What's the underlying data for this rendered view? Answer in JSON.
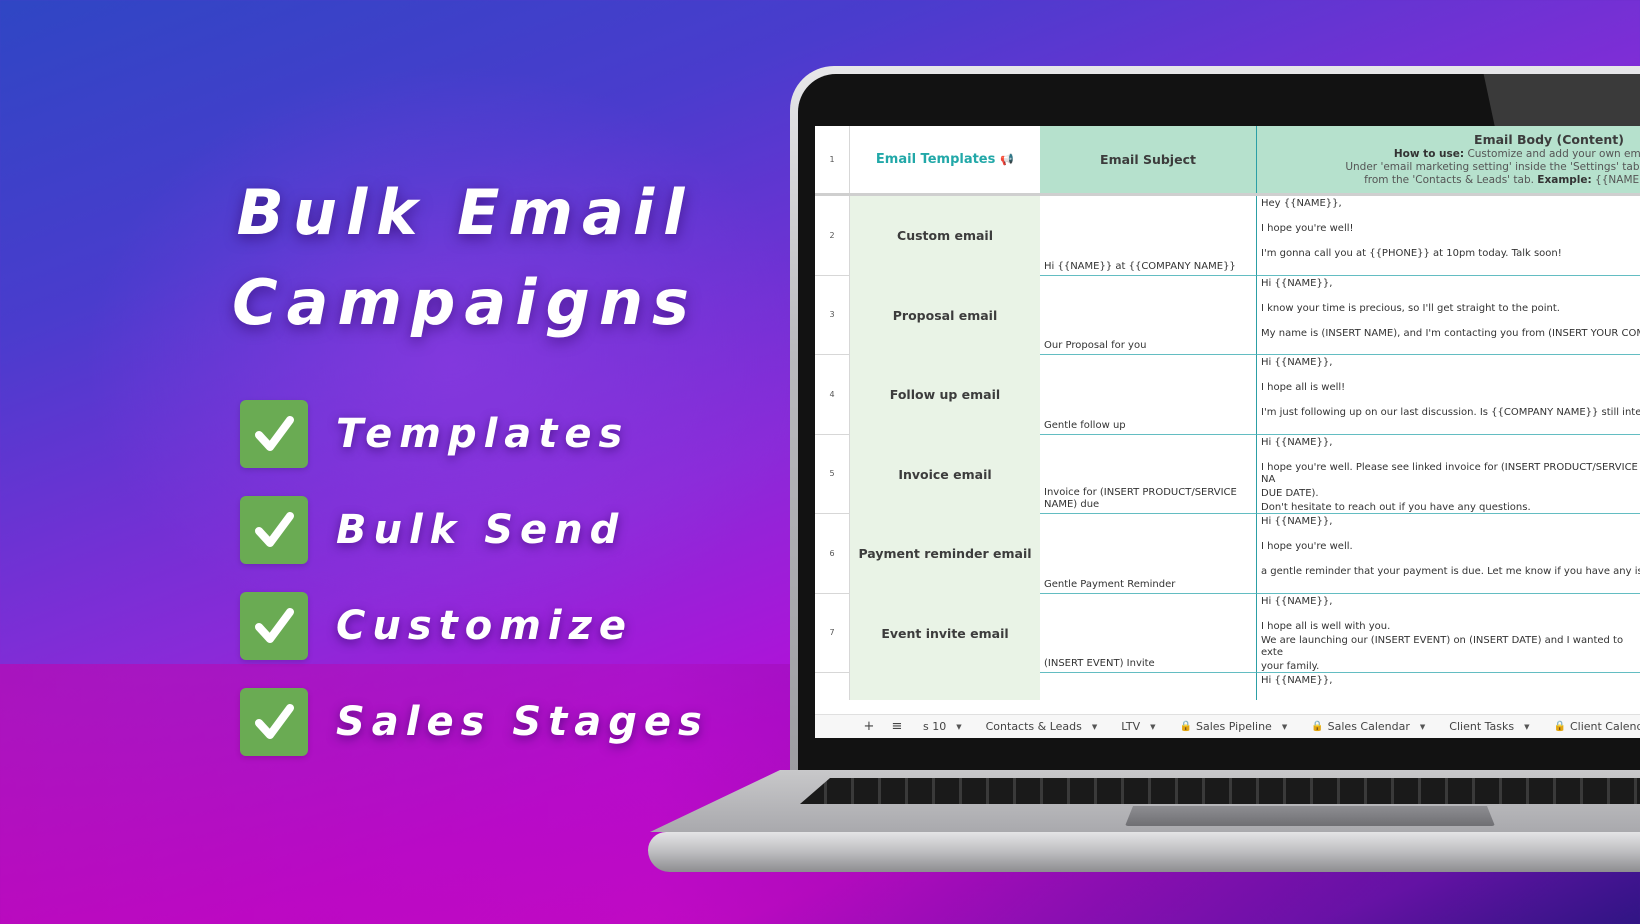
{
  "promo": {
    "headline_line1": "Bulk Email",
    "headline_line2": "Campaigns",
    "features": [
      {
        "label": "Templates",
        "icon": "checkmark-icon"
      },
      {
        "label": "Bulk Send",
        "icon": "checkmark-icon"
      },
      {
        "label": "Customize",
        "icon": "checkmark-icon"
      },
      {
        "label": "Sales Stages",
        "icon": "checkmark-icon"
      }
    ],
    "check_color": "#6aab53"
  },
  "spreadsheet": {
    "header": {
      "row_number": "1",
      "col_type": "Email Templates",
      "col_type_icon": "megaphone-icon",
      "col_subject": "Email Subject",
      "col_body_title": "Email Body (Content)",
      "col_body_howto_label": "How to use:",
      "col_body_howto_text": " Customize and add your own email subject a",
      "col_body_line2": "Under 'email marketing setting' inside the 'Settings' tab, you can add the coc",
      "col_body_line3_pre": "from the 'Contacts & Leads' tab. ",
      "col_body_example_label": "Example:",
      "col_body_line3_post": " {{NAME}} corrosponds to"
    },
    "rows": [
      {
        "row_number": "2",
        "type": "Custom email",
        "subject": "Hi {{NAME}} at {{COMPANY NAME}}",
        "body": [
          "Hey {{NAME}},",
          "I hope you're well!",
          "I'm gonna call you at {{PHONE}} at 10pm today. Talk soon!"
        ]
      },
      {
        "row_number": "3",
        "type": "Proposal email",
        "subject": "Our Proposal for you",
        "body": [
          "Hi {{NAME}},",
          "I know your time is precious, so I'll get straight to the point.",
          "My name is (INSERT NAME), and I'm contacting you from (INSERT YOUR COMP"
        ]
      },
      {
        "row_number": "4",
        "type": "Follow up email",
        "subject": "Gentle follow up",
        "body": [
          "Hi {{NAME}},",
          "I hope all is well!",
          "I'm just following up on our last discussion. Is {{COMPANY NAME}} still intereste"
        ]
      },
      {
        "row_number": "5",
        "type": "Invoice email",
        "subject": "Invoice for (INSERT PRODUCT/SERVICE NAME) due",
        "body": [
          "Hi {{NAME}},",
          "I hope you're well. Please see linked invoice for (INSERT PRODUCT/SERVICE NA",
          "DUE DATE).",
          "Don't hesitate to reach out if you have any questions."
        ]
      },
      {
        "row_number": "6",
        "type": "Payment reminder email",
        "subject": "Gentle Payment Reminder",
        "body": [
          "Hi {{NAME}},",
          "I hope you're well.",
          " a gentle reminder that your payment is due. Let me know if you have any issu"
        ]
      },
      {
        "row_number": "7",
        "type": "Event invite email",
        "subject": "(INSERT EVENT) Invite",
        "body": [
          "Hi {{NAME}},",
          "I hope all is well with you.",
          "We are launching our (INSERT EVENT) on (INSERT DATE) and I wanted to exte",
          "your family."
        ]
      }
    ],
    "partial_row_body": "Hi {{NAME}},",
    "accent_teal": "#22a8a8",
    "header_green": "#b6e1cd",
    "type_column_green": "#e9f3e6"
  },
  "tabbar": {
    "add_sheet": "+",
    "all_sheets": "≡",
    "tabs": [
      {
        "label": "s 10",
        "locked": false
      },
      {
        "label": "Contacts & Leads",
        "locked": false
      },
      {
        "label": "LTV",
        "locked": false
      },
      {
        "label": "Sales Pipeline",
        "locked": true
      },
      {
        "label": "Sales Calendar",
        "locked": true
      },
      {
        "label": "Client Tasks",
        "locked": false
      },
      {
        "label": "Client Calendar",
        "locked": true
      }
    ]
  }
}
